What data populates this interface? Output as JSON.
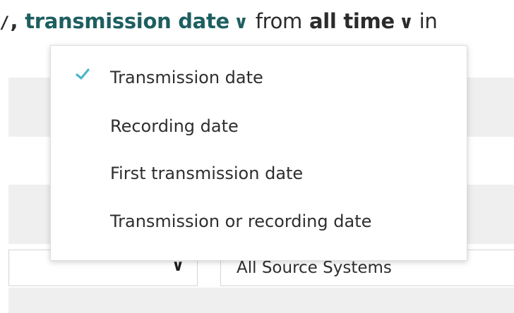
{
  "colors": {
    "accent_teal": "#1e5f60",
    "check_mark": "#4ab6cc",
    "band_grey": "#efefef",
    "text": "#2e2e2e"
  },
  "filter_sentence": {
    "partial_fragment": "/",
    "comma": ",",
    "date_type_label": "transmission date",
    "date_type_chevron_icon": "chevron-down-icon",
    "from_word": "from",
    "time_range_label": "all time",
    "time_range_chevron_icon": "chevron-down-icon",
    "in_word": "in"
  },
  "dropdown": {
    "selected_index": 0,
    "items": [
      {
        "label": "Transmission date",
        "selected": true,
        "icon": "check-icon"
      },
      {
        "label": "Recording date",
        "selected": false
      },
      {
        "label": "First transmission date",
        "selected": false
      },
      {
        "label": "Transmission or recording date",
        "selected": false
      }
    ]
  },
  "background_form": {
    "left_select_chevron_icon": "chevron-down-icon",
    "source_systems_value": "All Source Systems"
  }
}
